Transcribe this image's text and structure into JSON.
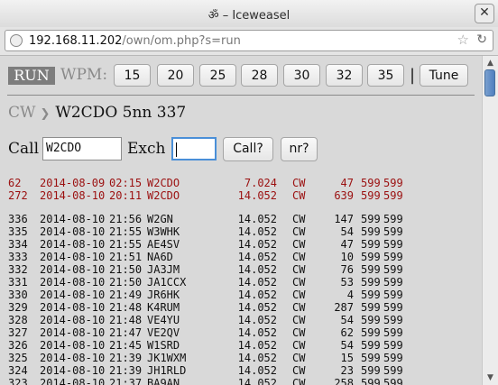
{
  "window": {
    "title": "ॐ – Iceweasel",
    "close_glyph": "✕"
  },
  "navbar": {
    "url_host": "192.168.11.202",
    "url_path": "/own/om.php?s=run"
  },
  "toolbar": {
    "run_label": "RUN",
    "wpm_label": "WPM:",
    "wpm_buttons": [
      "15",
      "20",
      "25",
      "28",
      "30",
      "32",
      "35"
    ],
    "separator": "|",
    "tune_label": "Tune"
  },
  "breadcrumb": {
    "mode": "CW",
    "chevron": "❯",
    "current": "W2CDO 5nn 337"
  },
  "form": {
    "call_label": "Call",
    "call_value": "W2CDO",
    "exch_label": "Exch",
    "exch_value": "",
    "call_button": "Call?",
    "nr_button": "nr?"
  },
  "dupes": [
    {
      "nr": "62",
      "date": "2014-08-09",
      "time": "02:15",
      "call": "W2CDO",
      "freq": "7.024",
      "mode": "CW",
      "rcvd": "47",
      "rst_s": "599",
      "rst_r": "599"
    },
    {
      "nr": "272",
      "date": "2014-08-10",
      "time": "20:11",
      "call": "W2CDO",
      "freq": "14.052",
      "mode": "CW",
      "rcvd": "639",
      "rst_s": "599",
      "rst_r": "599"
    }
  ],
  "log": [
    {
      "nr": "336",
      "date": "2014-08-10",
      "time": "21:56",
      "call": "W2GN",
      "freq": "14.052",
      "mode": "CW",
      "rcvd": "147",
      "rst_s": "599",
      "rst_r": "599"
    },
    {
      "nr": "335",
      "date": "2014-08-10",
      "time": "21:55",
      "call": "W3WHK",
      "freq": "14.052",
      "mode": "CW",
      "rcvd": "54",
      "rst_s": "599",
      "rst_r": "599"
    },
    {
      "nr": "334",
      "date": "2014-08-10",
      "time": "21:55",
      "call": "AE4SV",
      "freq": "14.052",
      "mode": "CW",
      "rcvd": "47",
      "rst_s": "599",
      "rst_r": "599"
    },
    {
      "nr": "333",
      "date": "2014-08-10",
      "time": "21:51",
      "call": "NA6D",
      "freq": "14.052",
      "mode": "CW",
      "rcvd": "10",
      "rst_s": "599",
      "rst_r": "599"
    },
    {
      "nr": "332",
      "date": "2014-08-10",
      "time": "21:50",
      "call": "JA3JM",
      "freq": "14.052",
      "mode": "CW",
      "rcvd": "76",
      "rst_s": "599",
      "rst_r": "599"
    },
    {
      "nr": "331",
      "date": "2014-08-10",
      "time": "21:50",
      "call": "JA1CCX",
      "freq": "14.052",
      "mode": "CW",
      "rcvd": "53",
      "rst_s": "599",
      "rst_r": "599"
    },
    {
      "nr": "330",
      "date": "2014-08-10",
      "time": "21:49",
      "call": "JR6HK",
      "freq": "14.052",
      "mode": "CW",
      "rcvd": "4",
      "rst_s": "599",
      "rst_r": "599"
    },
    {
      "nr": "329",
      "date": "2014-08-10",
      "time": "21:48",
      "call": "K4RUM",
      "freq": "14.052",
      "mode": "CW",
      "rcvd": "287",
      "rst_s": "599",
      "rst_r": "599"
    },
    {
      "nr": "328",
      "date": "2014-08-10",
      "time": "21:48",
      "call": "VE4YU",
      "freq": "14.052",
      "mode": "CW",
      "rcvd": "54",
      "rst_s": "599",
      "rst_r": "599"
    },
    {
      "nr": "327",
      "date": "2014-08-10",
      "time": "21:47",
      "call": "VE2QV",
      "freq": "14.052",
      "mode": "CW",
      "rcvd": "62",
      "rst_s": "599",
      "rst_r": "599"
    },
    {
      "nr": "326",
      "date": "2014-08-10",
      "time": "21:45",
      "call": "W1SRD",
      "freq": "14.052",
      "mode": "CW",
      "rcvd": "54",
      "rst_s": "599",
      "rst_r": "599"
    },
    {
      "nr": "325",
      "date": "2014-08-10",
      "time": "21:39",
      "call": "JK1WXM",
      "freq": "14.052",
      "mode": "CW",
      "rcvd": "15",
      "rst_s": "599",
      "rst_r": "599"
    },
    {
      "nr": "324",
      "date": "2014-08-10",
      "time": "21:39",
      "call": "JH1RLD",
      "freq": "14.052",
      "mode": "CW",
      "rcvd": "23",
      "rst_s": "599",
      "rst_r": "599"
    },
    {
      "nr": "323",
      "date": "2014-08-10",
      "time": "21:37",
      "call": "BA9AN",
      "freq": "14.052",
      "mode": "CW",
      "rcvd": "258",
      "rst_s": "599",
      "rst_r": "599"
    }
  ]
}
